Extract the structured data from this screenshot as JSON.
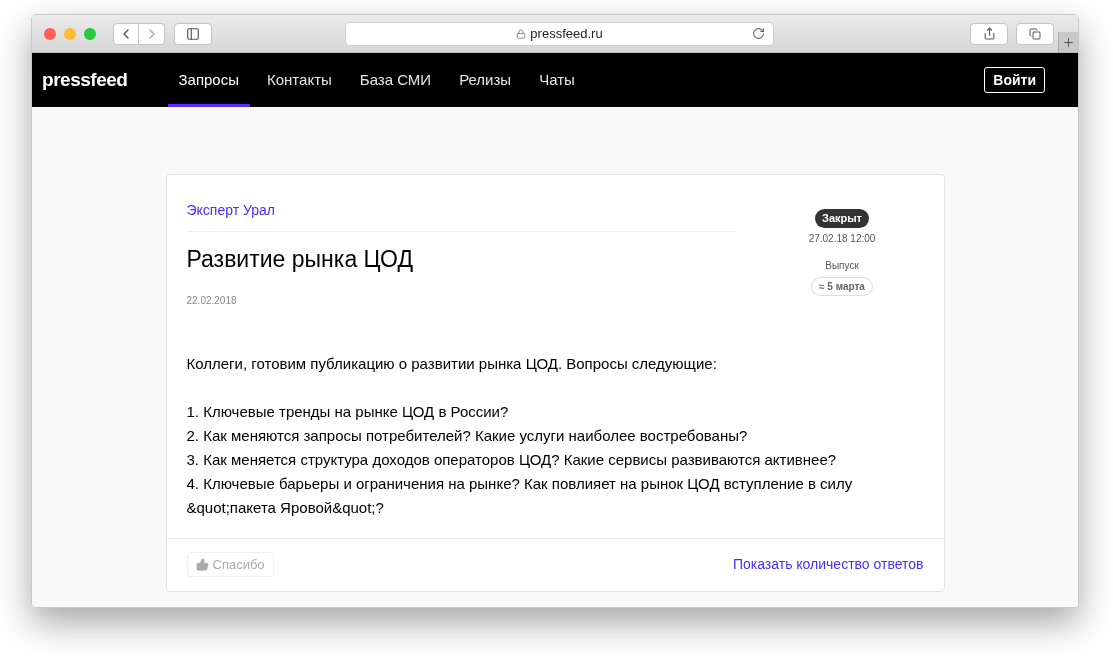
{
  "browser": {
    "address": "pressfeed.ru"
  },
  "nav": {
    "logo": "pressfeed",
    "items": [
      {
        "label": "Запросы",
        "selected": true
      },
      {
        "label": "Контакты",
        "selected": false
      },
      {
        "label": "База СМИ",
        "selected": false
      },
      {
        "label": "Релизы",
        "selected": false
      },
      {
        "label": "Чаты",
        "selected": false
      }
    ],
    "login": "Войти"
  },
  "request": {
    "outlet": "Эксперт Урал",
    "title": "Развитие рынка ЦОД",
    "date": "22.02.2018",
    "status": "Закрыт",
    "deadline": "27.02.18 12:00",
    "release_label": "Выпуск",
    "release": "≈ 5 марта",
    "intro": "Коллеги, готовим публикацию о развитии рынка ЦОД. Вопросы следующие:",
    "questions": [
      "1. Ключевые тренды на рынке ЦОД в России?",
      "2. Как меняются запросы потребителей? Какие услуги наиболее востребованы?",
      "3. Как меняется структура доходов операторов ЦОД? Какие сервисы развиваются активнее?",
      "4. Ключевые барьеры и ограничения на рынке? Как повлияет на рынок ЦОД вступление в силу &quot;пакета Яровой&quot;?"
    ],
    "thanks": {
      "label": "Спасибо",
      "disabled": true
    },
    "show_answers": "Показать количество ответов"
  }
}
